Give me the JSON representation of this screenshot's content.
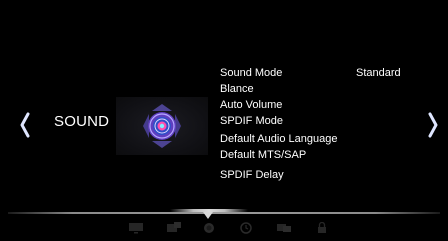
{
  "category": {
    "title": "SOUND",
    "icon": "sound-speaker-icon"
  },
  "menu": {
    "items": [
      {
        "label": "Sound Mode",
        "value": "Standard"
      },
      {
        "label": "Blance"
      },
      {
        "label": "Auto Volume"
      },
      {
        "label": "SPDIF Mode"
      },
      {
        "label": "Default Audio Language"
      },
      {
        "label": "Default MTS/SAP"
      },
      {
        "label": "SPDIF Delay"
      }
    ]
  },
  "navigation": {
    "left_icon": "chevron-left-icon",
    "right_icon": "chevron-right-icon"
  },
  "bottom_bar": {
    "icons": [
      "picture-icon",
      "channel-icon",
      "sound-icon",
      "time-icon",
      "option-icon",
      "lock-icon"
    ],
    "selected": "sound-icon"
  },
  "colors": {
    "background": "#000000",
    "text": "#ffffff",
    "icon_purple": "#5a4fb0",
    "icon_blue": "#2f4fc8"
  }
}
